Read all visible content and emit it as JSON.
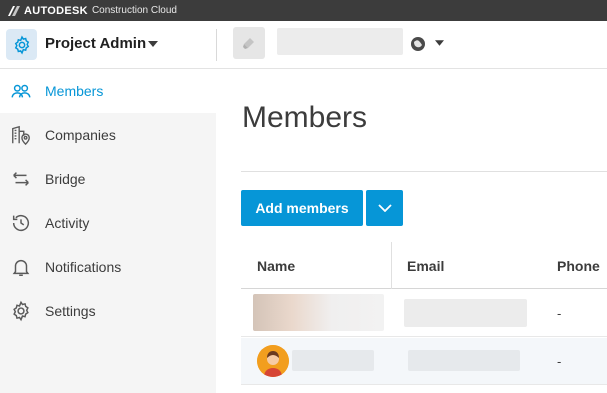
{
  "topbar": {
    "brand": "AUTODESK",
    "product": "Construction Cloud"
  },
  "header": {
    "module_title": "Project Admin",
    "project_name": ""
  },
  "sidebar": {
    "items": [
      {
        "label": "Members",
        "icon": "people-icon",
        "active": true
      },
      {
        "label": "Companies",
        "icon": "building-pin-icon",
        "active": false
      },
      {
        "label": "Bridge",
        "icon": "bridge-arrows-icon",
        "active": false
      },
      {
        "label": "Activity",
        "icon": "history-icon",
        "active": false
      },
      {
        "label": "Notifications",
        "icon": "bell-icon",
        "active": false
      },
      {
        "label": "Settings",
        "icon": "gear-icon",
        "active": false
      }
    ]
  },
  "main": {
    "title": "Members",
    "add_button": "Add members",
    "table": {
      "columns": [
        "Name",
        "Email",
        "Phone"
      ],
      "rows": [
        {
          "name": "",
          "email": "",
          "phone": "-"
        },
        {
          "name": "",
          "email": "",
          "phone": "-"
        }
      ]
    }
  },
  "colors": {
    "accent": "#0696d7",
    "topbar": "#3c3c3c",
    "sidebar_bg": "#f5f5f5"
  }
}
